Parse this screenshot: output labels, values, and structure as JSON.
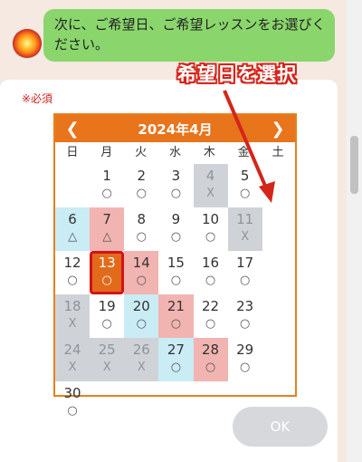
{
  "chat": {
    "message": "次に、ご希望日、ご希望レッスンをお選びください。",
    "avatar_icon": "sun-avatar-icon"
  },
  "form": {
    "required_label": "※必須"
  },
  "annotation": {
    "text": "希望日を選択",
    "color": "#d4251b"
  },
  "calendar": {
    "title": "2024年4月",
    "prev_icon": "chevron-left-icon",
    "next_icon": "chevron-right-icon",
    "weekdays": [
      "日",
      "月",
      "火",
      "水",
      "木",
      "金",
      "土"
    ],
    "days": [
      {
        "d": "",
        "m": "",
        "type": "empty"
      },
      {
        "d": "1",
        "m": "○",
        "type": "open"
      },
      {
        "d": "2",
        "m": "○",
        "type": "open"
      },
      {
        "d": "3",
        "m": "○",
        "type": "open"
      },
      {
        "d": "4",
        "m": "X",
        "type": "closed"
      },
      {
        "d": "5",
        "m": "○",
        "type": "open"
      },
      {
        "d": "6",
        "m": "△",
        "type": "sat"
      },
      {
        "d": "7",
        "m": "△",
        "type": "sun"
      },
      {
        "d": "8",
        "m": "○",
        "type": "open"
      },
      {
        "d": "9",
        "m": "○",
        "type": "open"
      },
      {
        "d": "10",
        "m": "○",
        "type": "open"
      },
      {
        "d": "11",
        "m": "X",
        "type": "closed"
      },
      {
        "d": "12",
        "m": "○",
        "type": "open"
      },
      {
        "d": "13",
        "m": "○",
        "type": "selected"
      },
      {
        "d": "14",
        "m": "○",
        "type": "sun"
      },
      {
        "d": "15",
        "m": "○",
        "type": "open"
      },
      {
        "d": "16",
        "m": "○",
        "type": "open"
      },
      {
        "d": "17",
        "m": "○",
        "type": "open"
      },
      {
        "d": "18",
        "m": "X",
        "type": "closed"
      },
      {
        "d": "19",
        "m": "○",
        "type": "open"
      },
      {
        "d": "20",
        "m": "○",
        "type": "sat"
      },
      {
        "d": "21",
        "m": "○",
        "type": "sun"
      },
      {
        "d": "22",
        "m": "○",
        "type": "open"
      },
      {
        "d": "23",
        "m": "○",
        "type": "open"
      },
      {
        "d": "24",
        "m": "X",
        "type": "closed"
      },
      {
        "d": "25",
        "m": "X",
        "type": "closed"
      },
      {
        "d": "26",
        "m": "X",
        "type": "closed"
      },
      {
        "d": "27",
        "m": "○",
        "type": "sat"
      },
      {
        "d": "28",
        "m": "○",
        "type": "sun"
      },
      {
        "d": "29",
        "m": "○",
        "type": "open"
      },
      {
        "d": "30",
        "m": "○",
        "type": "open"
      }
    ]
  },
  "ok_button": {
    "label": "OK"
  }
}
